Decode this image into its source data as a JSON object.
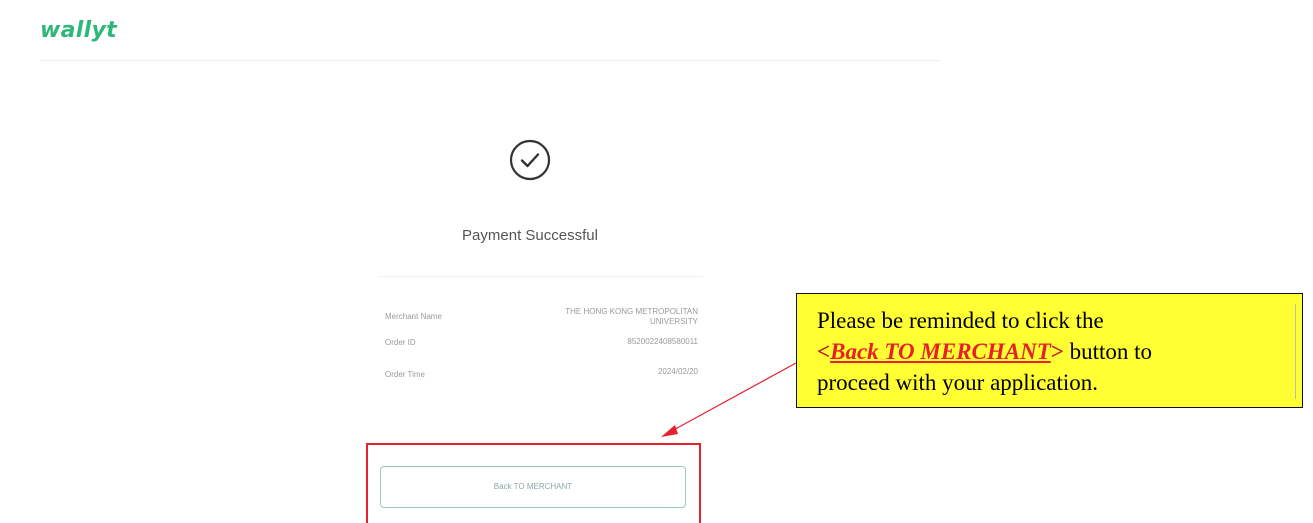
{
  "brand": {
    "logo_text": "wallyt",
    "color": "#2fb77a"
  },
  "status": {
    "icon": "check-circle-icon",
    "title": "Payment Successful"
  },
  "details": {
    "merchant_name_label": "Merchant Name",
    "merchant_name_value": "THE HONG KONG METROPOLITAN UNIVERSITY",
    "order_id_label": "Order ID",
    "order_id_value": "8520022408580011",
    "order_time_label": "Order Time",
    "order_time_value": "2024/02/20"
  },
  "actions": {
    "back_label": "Back TO MERCHANT"
  },
  "annotation": {
    "line1": "Please be reminded to click the",
    "bracket_open": "<",
    "link_text": "Back TO MERCHANT",
    "bracket_close": ">",
    "after_link": " button to",
    "line3": "proceed with your application.",
    "highlight_color": "#ffff33",
    "accent_color": "#e8202a"
  }
}
